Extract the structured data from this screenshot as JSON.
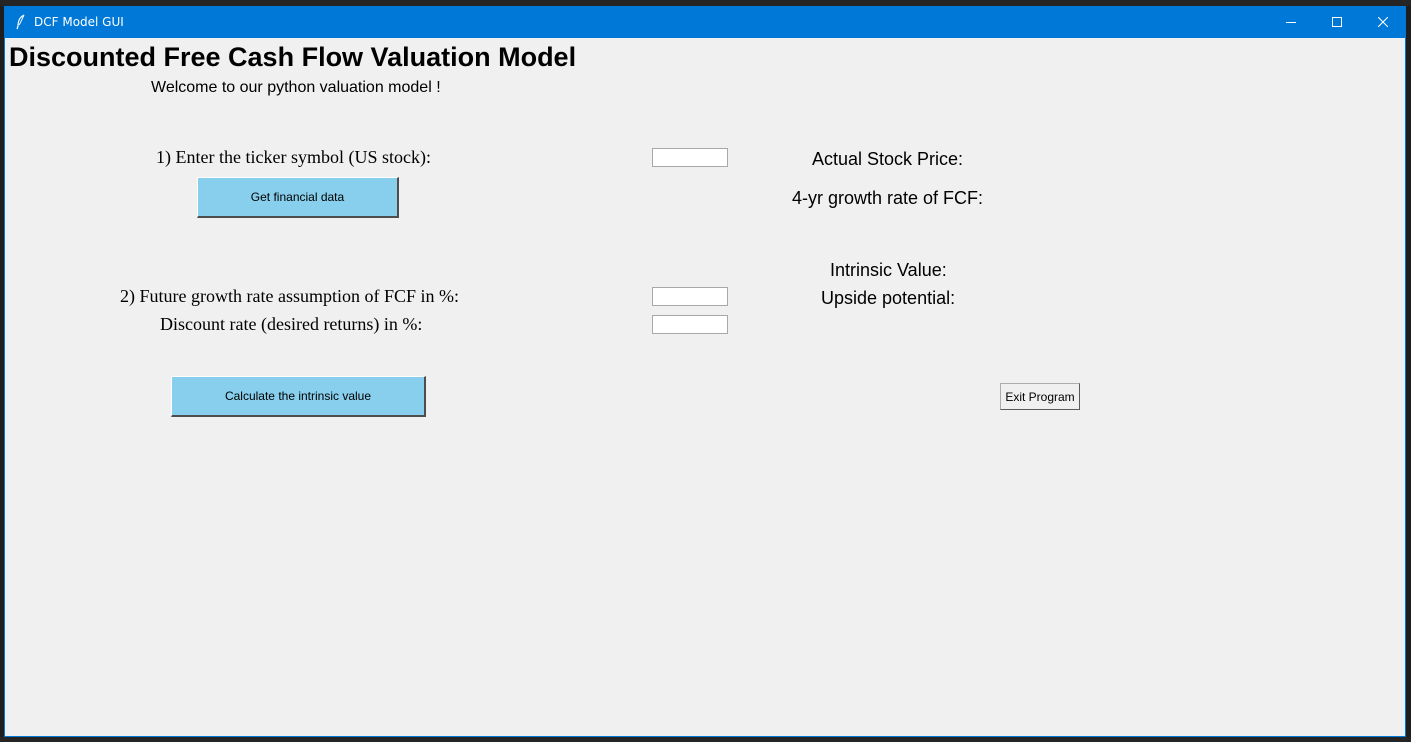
{
  "window": {
    "title": "DCF Model GUI",
    "icon": "feather-icon",
    "controls": [
      "minimize-icon",
      "maximize-icon",
      "close-icon"
    ],
    "accent_color": "#0078d7"
  },
  "header": {
    "title": "Discounted Free Cash Flow Valuation Model",
    "welcome": "Welcome to our python valuation model !"
  },
  "inputs": {
    "ticker_label": "1) Enter the ticker symbol (US stock):",
    "ticker_value": "",
    "growth_label": "2) Future growth rate assumption of FCF in %:",
    "growth_value": "",
    "discount_label": "Discount rate (desired returns) in %:",
    "discount_value": ""
  },
  "buttons": {
    "get_data": "Get financial data",
    "calculate": "Calculate the intrinsic value",
    "exit": "Exit Program",
    "button_color": "#87cfec"
  },
  "results": {
    "stock_price_label": "Actual Stock Price:",
    "growth_rate_label": "4-yr growth rate of FCF:",
    "intrinsic_value_label": "Intrinsic Value:",
    "upside_label": "Upside potential:"
  }
}
